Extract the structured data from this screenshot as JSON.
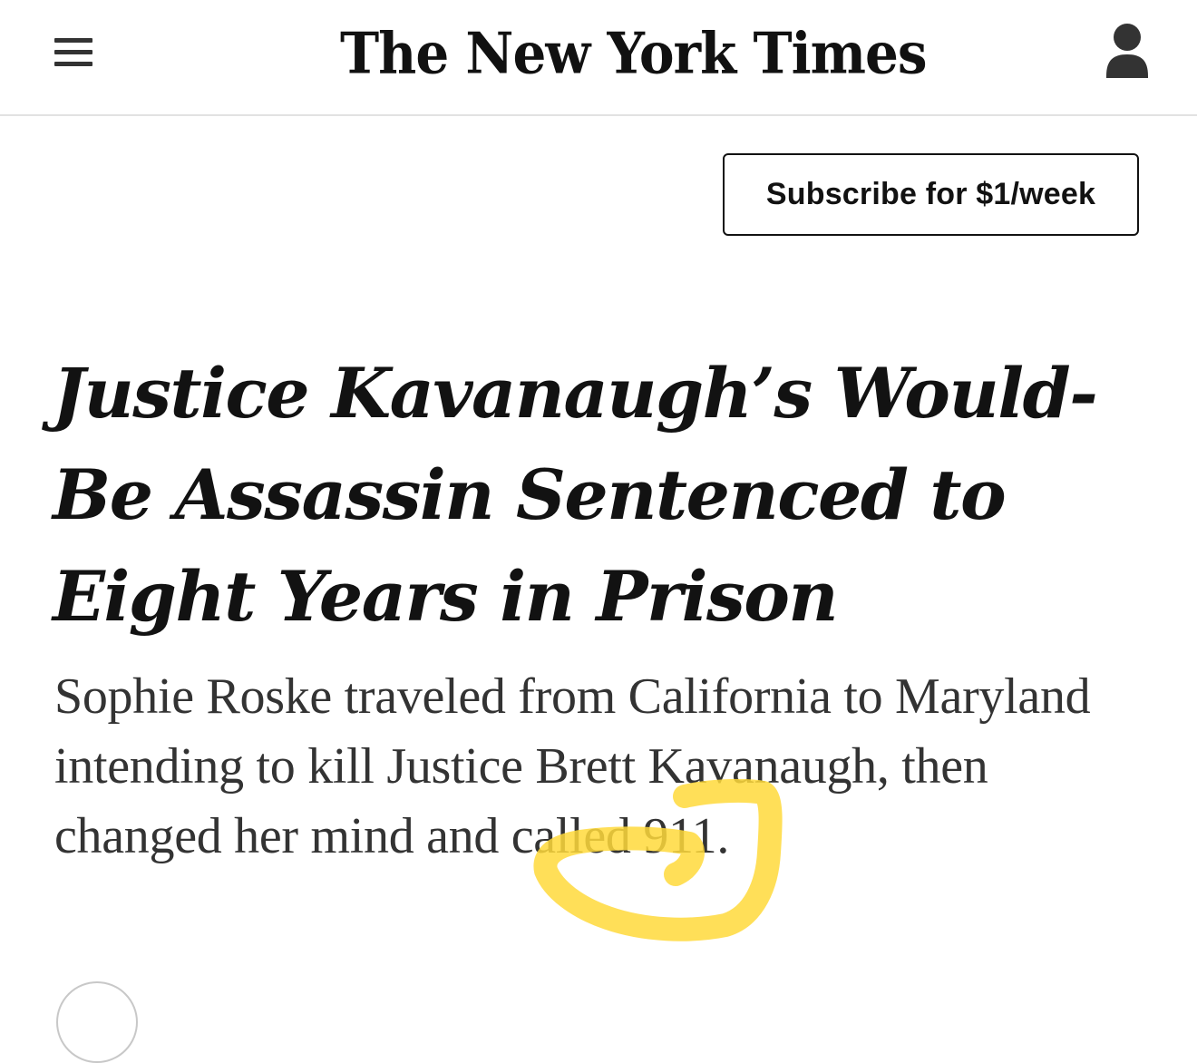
{
  "header": {
    "logo_text": "The New York Times",
    "menu_icon": "hamburger-menu-icon",
    "account_icon": "user-account-icon"
  },
  "subscribe": {
    "label": "Subscribe for $1/week"
  },
  "article": {
    "headline": "Justice Kavanaugh’s Would-Be Assassin Sentenced to Eight Years in Prison",
    "summary": "Sophie Roske traveled from California to Maryland intending to kill Justice Brett Kavanaugh, then changed her mind and called 911."
  },
  "annotation": {
    "highlight_color": "#FFD93B"
  },
  "colors": {
    "text": "#121212",
    "summary_text": "#333333",
    "divider": "#e2e2e2"
  }
}
